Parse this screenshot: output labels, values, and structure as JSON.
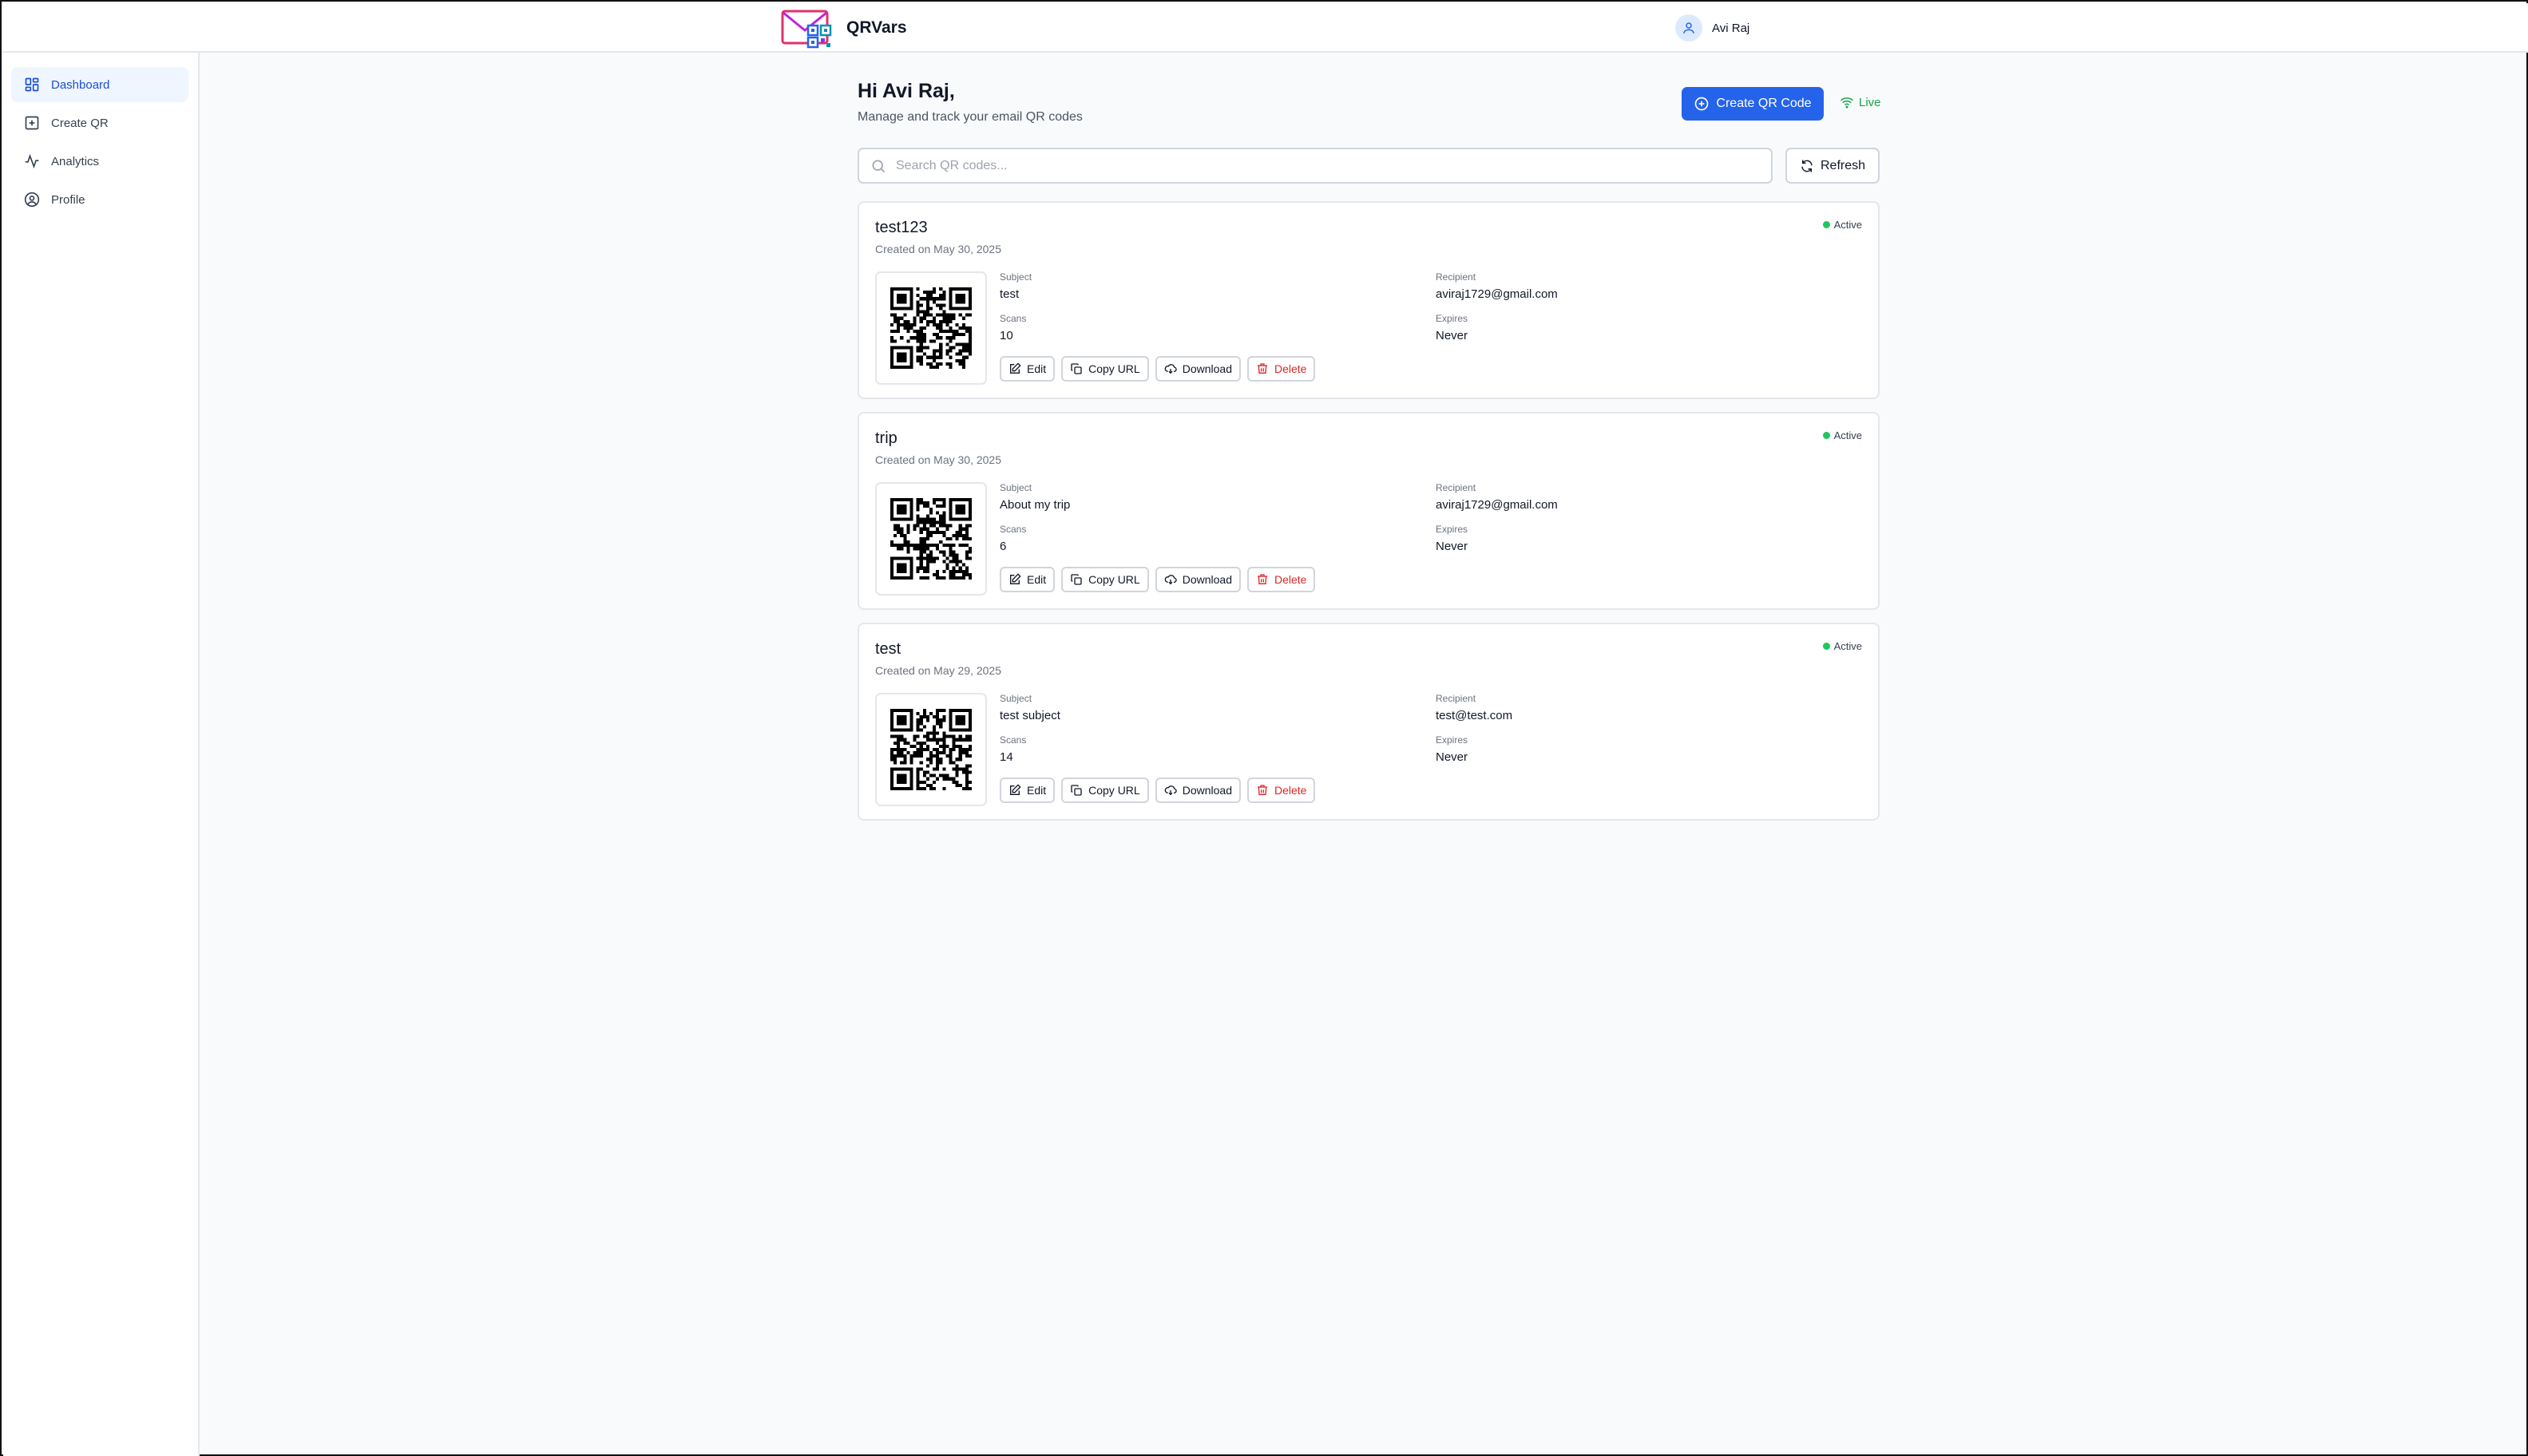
{
  "header": {
    "app_name": "QRVars",
    "user_name": "Avi Raj"
  },
  "sidebar": {
    "items": [
      {
        "label": "Dashboard",
        "icon": "dashboard-icon",
        "active": true
      },
      {
        "label": "Create QR",
        "icon": "plus-square-icon",
        "active": false
      },
      {
        "label": "Analytics",
        "icon": "activity-icon",
        "active": false
      },
      {
        "label": "Profile",
        "icon": "user-circle-icon",
        "active": false
      }
    ]
  },
  "main": {
    "greeting": "Hi Avi Raj,",
    "subtitle": "Manage and track your email QR codes",
    "create_label": "Create QR Code",
    "live_label": "Live",
    "search_placeholder": "Search QR codes...",
    "refresh_label": "Refresh"
  },
  "labels": {
    "subject": "Subject",
    "recipient": "Recipient",
    "scans": "Scans",
    "expires": "Expires",
    "edit": "Edit",
    "copy_url": "Copy URL",
    "download": "Download",
    "delete": "Delete"
  },
  "cards": [
    {
      "title": "test123",
      "created": "Created on May 30, 2025",
      "status": "Active",
      "subject": "test",
      "recipient": "aviraj1729@gmail.com",
      "scans": "10",
      "expires": "Never"
    },
    {
      "title": "trip",
      "created": "Created on May 30, 2025",
      "status": "Active",
      "subject": "About my trip",
      "recipient": "aviraj1729@gmail.com",
      "scans": "6",
      "expires": "Never"
    },
    {
      "title": "test",
      "created": "Created on May 29, 2025",
      "status": "Active",
      "subject": "test subject",
      "recipient": "test@test.com",
      "scans": "14",
      "expires": "Never"
    }
  ],
  "colors": {
    "accent": "#2563eb",
    "live": "#16a34a",
    "active_dot": "#22c55e",
    "danger": "#dc2626"
  }
}
